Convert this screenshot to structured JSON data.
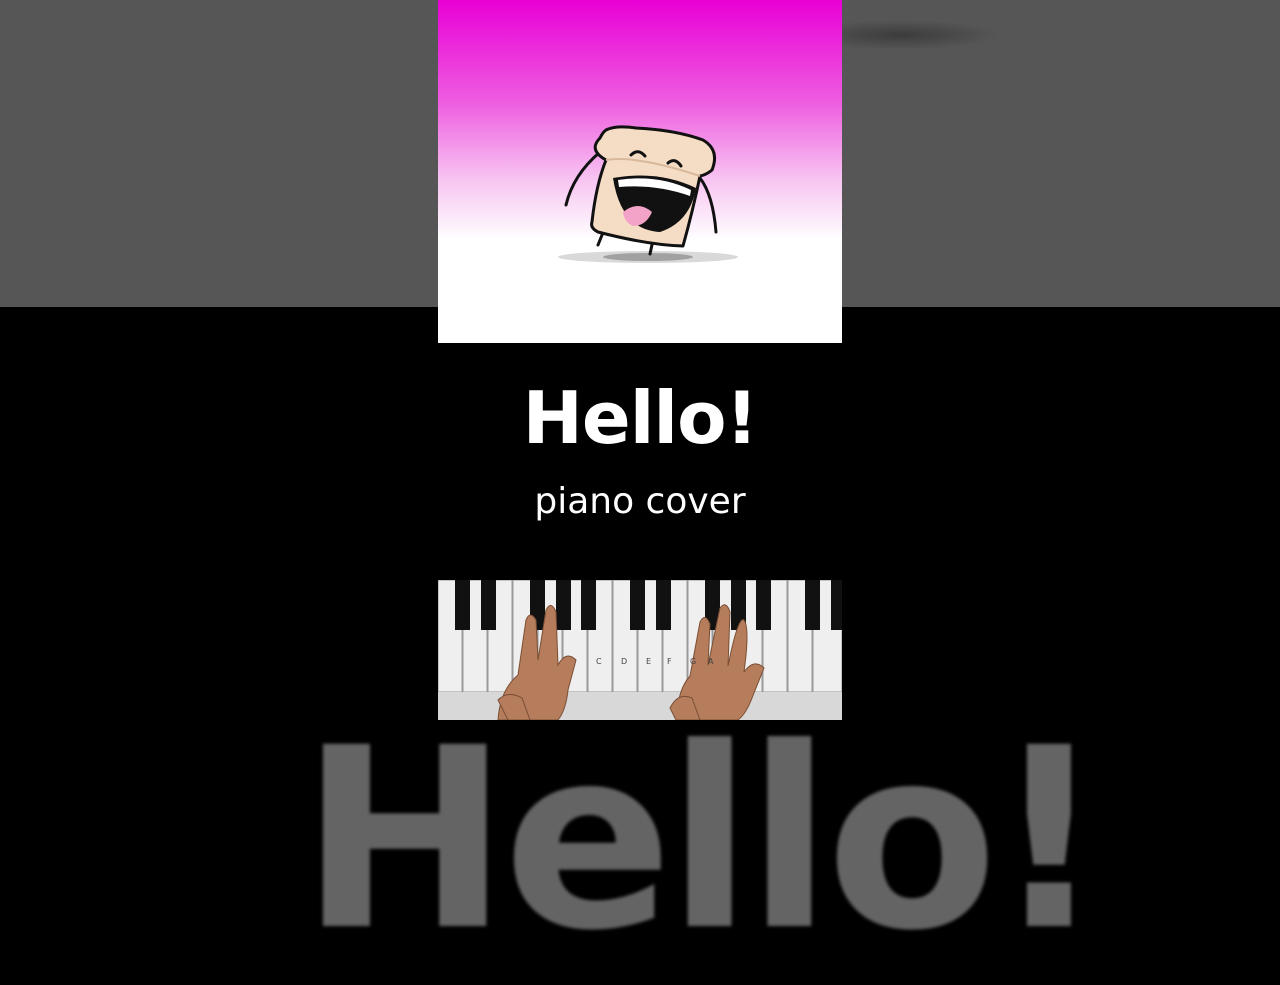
{
  "video": {
    "title": "Hello!",
    "subtitle": "piano cover",
    "background_text": "Hello!"
  },
  "piano_keys": [
    "C",
    "D",
    "E",
    "F",
    "G",
    "A"
  ],
  "colors": {
    "gradient_top": "#e900d6",
    "backdrop": "#565656",
    "ghost_text": "#646464"
  }
}
